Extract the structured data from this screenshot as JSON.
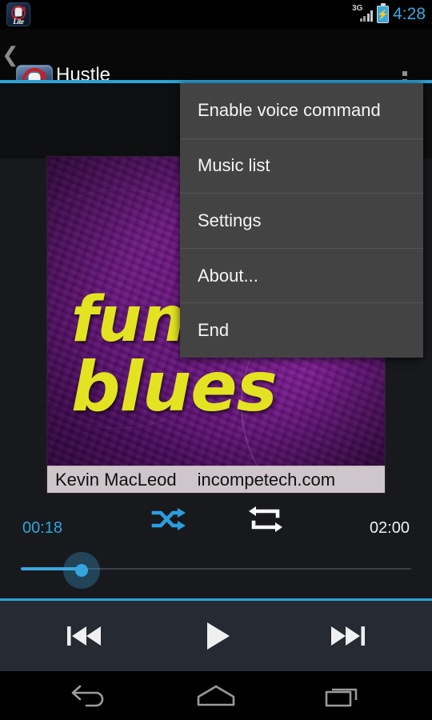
{
  "status_bar": {
    "app_icon": "no-hand-lite-icon",
    "network_label": "3G",
    "signal_icon": "signal-bars-icon",
    "battery_icon": "battery-charging-icon",
    "battery_bolt": "⚡",
    "clock": "4:28"
  },
  "action_bar": {
    "back_icon": "back-chevron-icon",
    "app_icon": "no-hand-lite-icon",
    "app_icon_label": "Lite",
    "track_title": "Hustle",
    "track_artist": "Kevin MacLeod",
    "overflow_icon": "overflow-menu-icon",
    "accent_color": "#2aa4d6"
  },
  "menu": {
    "items": [
      {
        "label": "Enable voice command",
        "name": "menu-item-enable-voice-command"
      },
      {
        "label": "Music list",
        "name": "menu-item-music-list"
      },
      {
        "label": "Settings",
        "name": "menu-item-settings"
      },
      {
        "label": "About...",
        "name": "menu-item-about"
      },
      {
        "label": "End",
        "name": "menu-item-end"
      }
    ],
    "background_color": "#434343",
    "text_color": "#f5f5f5"
  },
  "album_art": {
    "word_1": "fun",
    "word_2": "blues",
    "credit_artist": "Kevin MacLeod",
    "credit_site": "incompetech.com",
    "text_color": "#e3e321",
    "background_color": "#6b1480"
  },
  "playback": {
    "shuffle_icon": "shuffle-icon",
    "shuffle_active": true,
    "shuffle_color": "#2a9fe0",
    "repeat_icon": "repeat-icon",
    "repeat_active": false,
    "repeat_color": "#ffffff",
    "time_elapsed": "00:18",
    "time_total": "02:00",
    "elapsed_color": "#2fa5dd",
    "progress_percent": 15,
    "previous_icon": "skip-previous-icon",
    "play_icon": "play-icon",
    "next_icon": "skip-next-icon"
  },
  "nav_bar": {
    "back_icon": "nav-back-icon",
    "home_icon": "nav-home-icon",
    "recent_icon": "nav-recent-apps-icon"
  }
}
